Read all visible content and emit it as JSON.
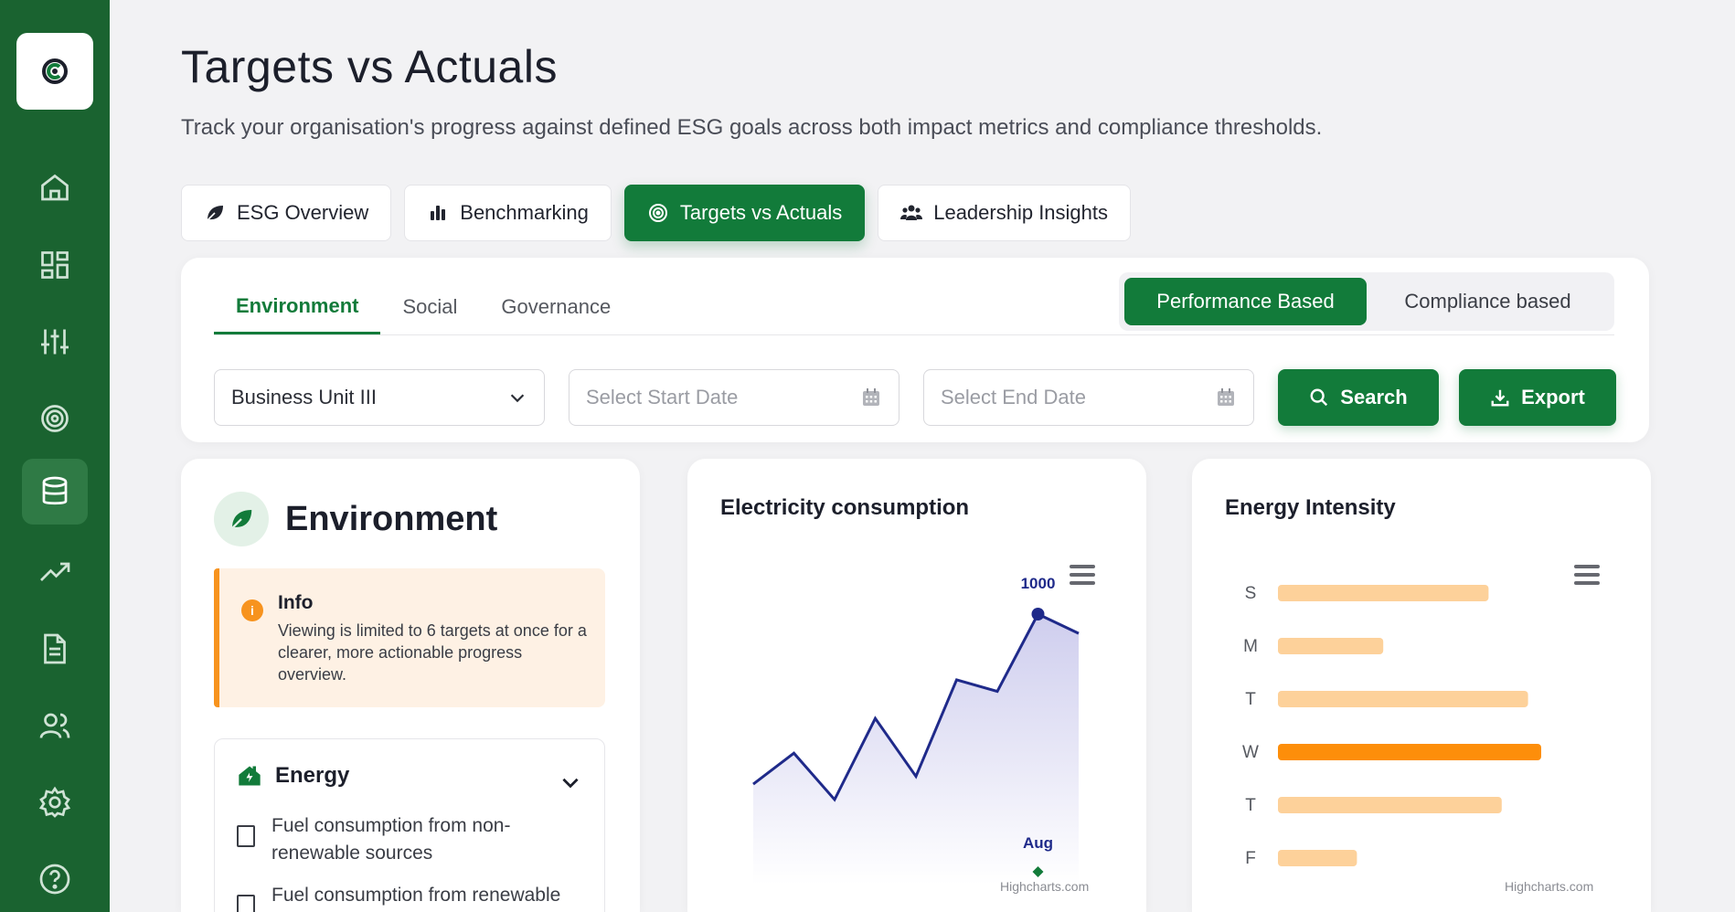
{
  "page": {
    "title": "Targets vs Actuals",
    "subtitle": "Track your organisation's progress against defined ESG goals across both impact metrics and compliance thresholds."
  },
  "sidebar": {
    "logo_icon": "logo-c-icon",
    "items": [
      {
        "icon": "home-icon"
      },
      {
        "icon": "dashboard-icon"
      },
      {
        "icon": "sliders-icon"
      },
      {
        "icon": "target-icon"
      },
      {
        "icon": "database-icon",
        "active": true
      },
      {
        "icon": "trending-icon"
      },
      {
        "icon": "document-icon"
      },
      {
        "icon": "users-icon"
      },
      {
        "icon": "settings-icon"
      },
      {
        "icon": "help-icon"
      }
    ]
  },
  "tabs": [
    {
      "label": "ESG Overview",
      "icon": "leaf-icon"
    },
    {
      "label": "Benchmarking",
      "icon": "bar-chart-icon"
    },
    {
      "label": "Targets vs Actuals",
      "icon": "target-icon",
      "active": true
    },
    {
      "label": "Leadership Insights",
      "icon": "users-icon"
    }
  ],
  "filters": {
    "subtabs": [
      {
        "label": "Environment",
        "active": true
      },
      {
        "label": "Social"
      },
      {
        "label": "Governance"
      }
    ],
    "toggle": [
      {
        "label": "Performance Based",
        "active": true
      },
      {
        "label": "Compliance based"
      }
    ],
    "business_unit": "Business Unit III",
    "start_date_placeholder": "Select Start Date",
    "end_date_placeholder": "Select End Date",
    "search_label": "Search",
    "export_label": "Export"
  },
  "environment_card": {
    "title": "Environment",
    "info_title": "Info",
    "info_text": "Viewing is limited to 6 targets at once for a clearer, more actionable progress overview.",
    "energy_title": "Energy",
    "items": [
      "Fuel consumption from non-renewable sources",
      "Fuel consumption from renewable"
    ]
  },
  "electricity_chart": {
    "title": "Electricity consumption",
    "credit": "Highcharts.com"
  },
  "energy_chart": {
    "title": "Energy Intensity",
    "credit": "Highcharts.com"
  },
  "colors": {
    "brand": "#127b3a",
    "sidebar": "#1a6330",
    "accent_orange": "#f7931e",
    "bar_light": "#fdd19a",
    "bar_highlight": "#fd8e0a",
    "line": "#1f2a8a"
  },
  "chart_data": [
    {
      "type": "area",
      "title": "Electricity consumption",
      "x_labels_visible": [
        "Aug"
      ],
      "series": [
        {
          "values": [
            560,
            640,
            520,
            730,
            580,
            830,
            800,
            1000,
            950
          ],
          "highlight_index": 7,
          "highlight_label": "1000",
          "highlight_x_label": "Aug"
        }
      ],
      "grid": false,
      "legend": "none"
    },
    {
      "type": "bar",
      "orientation": "horizontal",
      "title": "Energy Intensity",
      "categories": [
        "S",
        "M",
        "T",
        "W",
        "T",
        "F"
      ],
      "values": [
        0.8,
        0.4,
        0.95,
        1.0,
        0.85,
        0.3
      ],
      "highlight_index": 3,
      "grid": false,
      "legend": "none"
    }
  ]
}
